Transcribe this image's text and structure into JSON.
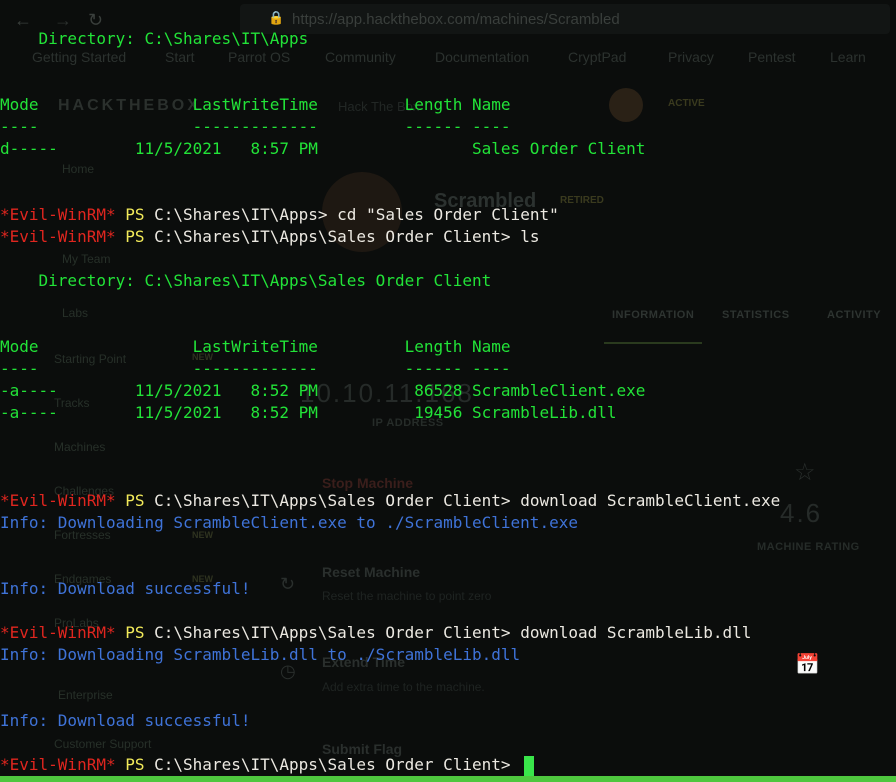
{
  "background": {
    "url": "https://app.hackthebox.com/machines/Scrambled",
    "bookmarks": [
      "Getting Started",
      "Start",
      "Parrot OS",
      "Community",
      "Documentation",
      "CryptPad",
      "Privacy",
      "Pentest",
      "Learn"
    ],
    "brand": "HACKTHEBOX",
    "brand_sub": "Hack The Box",
    "status": "ACTIVE",
    "sidebar": [
      "Home",
      "My Team",
      "Labs",
      "Starting Point",
      "Tracks",
      "Machines",
      "Challenges",
      "Fortresses",
      "Endgames",
      "ProLabs",
      "Enterprise",
      "Customer Support"
    ],
    "new_badge": "NEW",
    "machine_name": "Scrambled",
    "retired": "RETIRED",
    "tabs": [
      "INFORMATION",
      "STATISTICS",
      "ACTIVITY"
    ],
    "ip": "10.10.11.168",
    "ip_label": "IP ADDRESS",
    "rating": "4.6",
    "rating_label": "MACHINE RATING",
    "actions": [
      {
        "title": "Stop Machine",
        "desc": ""
      },
      {
        "title": "Reset Machine",
        "desc": "Reset the machine to point zero"
      },
      {
        "title": "Extend Time",
        "desc": "Add extra time to the machine."
      },
      {
        "title": "Submit Flag",
        "desc": ""
      }
    ]
  },
  "terminal": {
    "dir_apps": "    Directory: C:\\Shares\\IT\\Apps",
    "header": "Mode                LastWriteTime         Length Name",
    "separator": "----                -------------         ------ ----",
    "row_dir": "d-----        11/5/2021   8:57 PM                Sales Order Client",
    "shell_name": "*Evil-WinRM*",
    "ps": "PS",
    "cmd1": "C:\\Shares\\IT\\Apps> cd \"Sales Order Client\"",
    "cmd2": "C:\\Shares\\IT\\Apps\\Sales Order Client> ls",
    "dir_soc": "    Directory: C:\\Shares\\IT\\Apps\\Sales Order Client",
    "row_exe": "-a----        11/5/2021   8:52 PM          86528 ScrambleClient.exe",
    "row_dll": "-a----        11/5/2021   8:52 PM          19456 ScrambleLib.dll",
    "cmd3": "C:\\Shares\\IT\\Apps\\Sales Order Client> download ScrambleClient.exe",
    "info1": "Info: Downloading ScrambleClient.exe to ./ScrambleClient.exe",
    "info_ok": "Info: Download successful!",
    "cmd4": "C:\\Shares\\IT\\Apps\\Sales Order Client> download ScrambleLib.dll",
    "info2": "Info: Downloading ScrambleLib.dll to ./ScrambleLib.dll",
    "cmd5": "C:\\Shares\\IT\\Apps\\Sales Order Client> "
  },
  "colors": {
    "green": "#22e338",
    "red": "#e0261f",
    "yellow": "#f2ea5a",
    "white": "#ece9e2",
    "blue": "#3f73d8"
  }
}
